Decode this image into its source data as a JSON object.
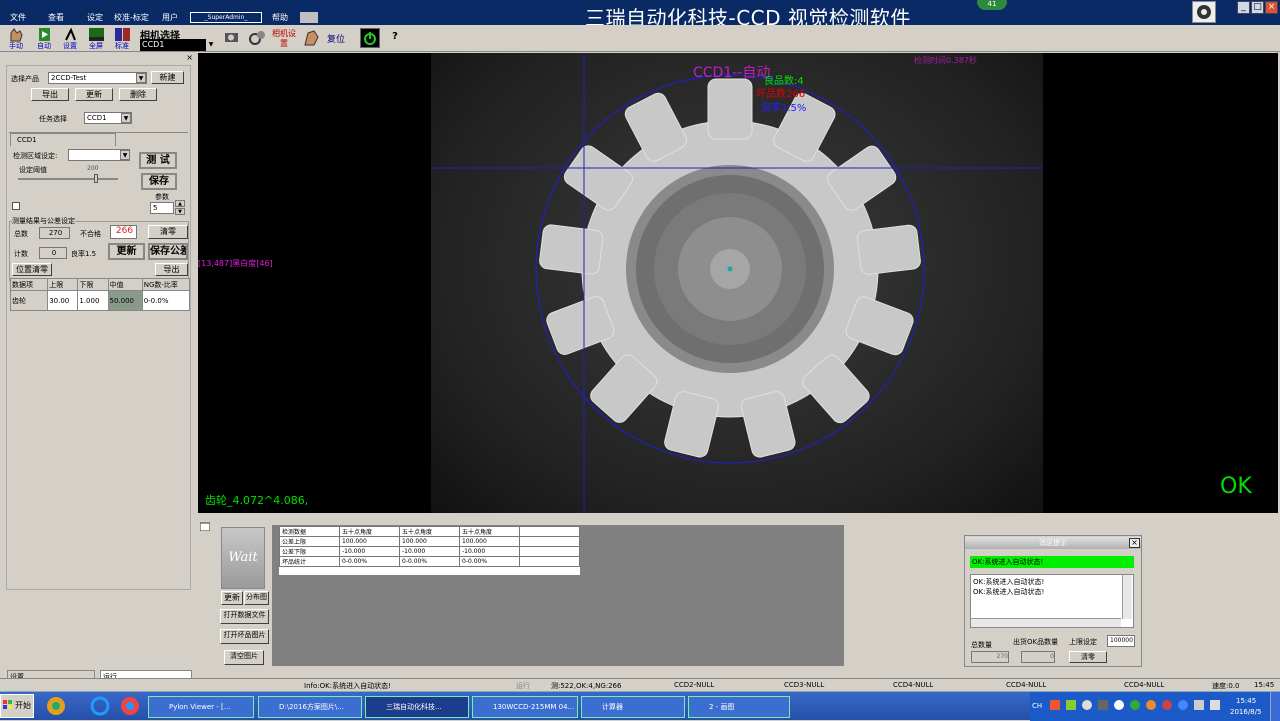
{
  "window": {
    "title": "三瑞自动化科技-CCD 视觉检测软件",
    "badge": "41"
  },
  "menu": [
    "文件",
    "查看",
    "设定",
    "校准-标定",
    "用户",
    "_SuperAdmin_",
    "帮助"
  ],
  "toolbar": {
    "items": [
      "手动",
      "自动",
      "设置",
      "全屏",
      "标准"
    ],
    "camera_title": "相机选择",
    "camera_value": "CCD1",
    "camera_settings": "相机设置",
    "reset": "复位",
    "help": "?"
  },
  "left": {
    "product_label": "选择产品",
    "product_value": "2CCD-Test",
    "new_btn": "新建",
    "export_btn": "导出",
    "update_btn": "更新",
    "delete_btn": "删除",
    "task_label": "任务选择",
    "task_value": "CCD1",
    "tab": "CCD1",
    "region_label": "检测区域设定:",
    "test_btn": "测 试",
    "threshold_label": "设定阈值",
    "threshold_value": "200",
    "save_btn": "保存",
    "param_label": "参数",
    "param_value": "5",
    "group_label": "测量结果与公差设定",
    "total_label": "总数",
    "total_value": "270",
    "ng_label": "不合格",
    "ng_value": "266",
    "clear_btn": "清零",
    "count_label": "计数",
    "count_value": "0",
    "yield_label": "良率1.5",
    "refresh_btn": "更新",
    "save_tol_btn": "保存公差",
    "pos_clear_btn": "位置清零",
    "export2_btn": "导出",
    "table_headers": [
      "数据项",
      "上限",
      "下限",
      "中值",
      "NG数-比率"
    ],
    "table_rows": [
      [
        "齿轮",
        "30.00",
        "1.000",
        "50.000",
        "0-0.0%"
      ]
    ],
    "tab_settings": "设置",
    "tab_run": "运行"
  },
  "viewer": {
    "overlay_title": "CCD1--自动",
    "good_count": "良品数:4",
    "bad_count": "坏品数266",
    "yield": "良率1.5%",
    "detect_time": "检测时间0.387秒",
    "pixel_info": "[13,487]黑白度[46]",
    "measure": "齿轮_4.072^4.086,",
    "result": "OK",
    "colors": {
      "title": "#c020c0",
      "good": "#00e000",
      "bad": "#e00000",
      "yield": "#2020ff",
      "ok": "#00e000"
    }
  },
  "bottom": {
    "wait": "Wait",
    "buttons": [
      "更新",
      "分布图",
      "打开数据文件",
      "打开坏品图片",
      "清空图片"
    ],
    "grid_headers": [
      "检测数据",
      "五十点角度",
      "五十点角度",
      "五十点角度"
    ],
    "grid_rows": [
      [
        "公差上限",
        "100.000",
        "100.000",
        "100.000"
      ],
      [
        "公差下限",
        "-10.000",
        "-10.000",
        "-10.000"
      ],
      [
        "坏品统计",
        "0-0.00%",
        "0-0.00%",
        "0-0.00%"
      ]
    ],
    "msg_title": "消息提示",
    "msg_status": "OK:系统进入自动状态!",
    "msg_log": [
      "OK:系统进入自动状态!",
      "OK:系统进入自动状态!"
    ],
    "total_label": "总数量",
    "ok_label": "出货OK品数量",
    "limit_label": "上限设定",
    "limit_value": "100000",
    "total_value": "270",
    "ok_value": "0",
    "clear_btn": "清零"
  },
  "status": {
    "info": "Info:OK:系统进入自动状态!",
    "run": "运行",
    "counts": "测:522,OK:4,NG:266",
    "ccd2": "CCD2-NULL",
    "ccd3": "CCD3-NULL",
    "ccd4a": "CCD4-NULL",
    "ccd4b": "CCD4-NULL",
    "ccd4c": "CCD4-NULL",
    "speed": "速度:0.0",
    "time": "15:45"
  },
  "taskbar": {
    "start": "开始",
    "tasks": [
      "Pylon Viewer - [...",
      "D:\\2016方案图片\\...",
      "三瑞自动化科技...",
      "130WCCD-215MM 04...",
      "计算器",
      "2 - 画图"
    ],
    "lang": "CH",
    "clock_time": "15:45",
    "clock_date": "2016/8/5"
  }
}
